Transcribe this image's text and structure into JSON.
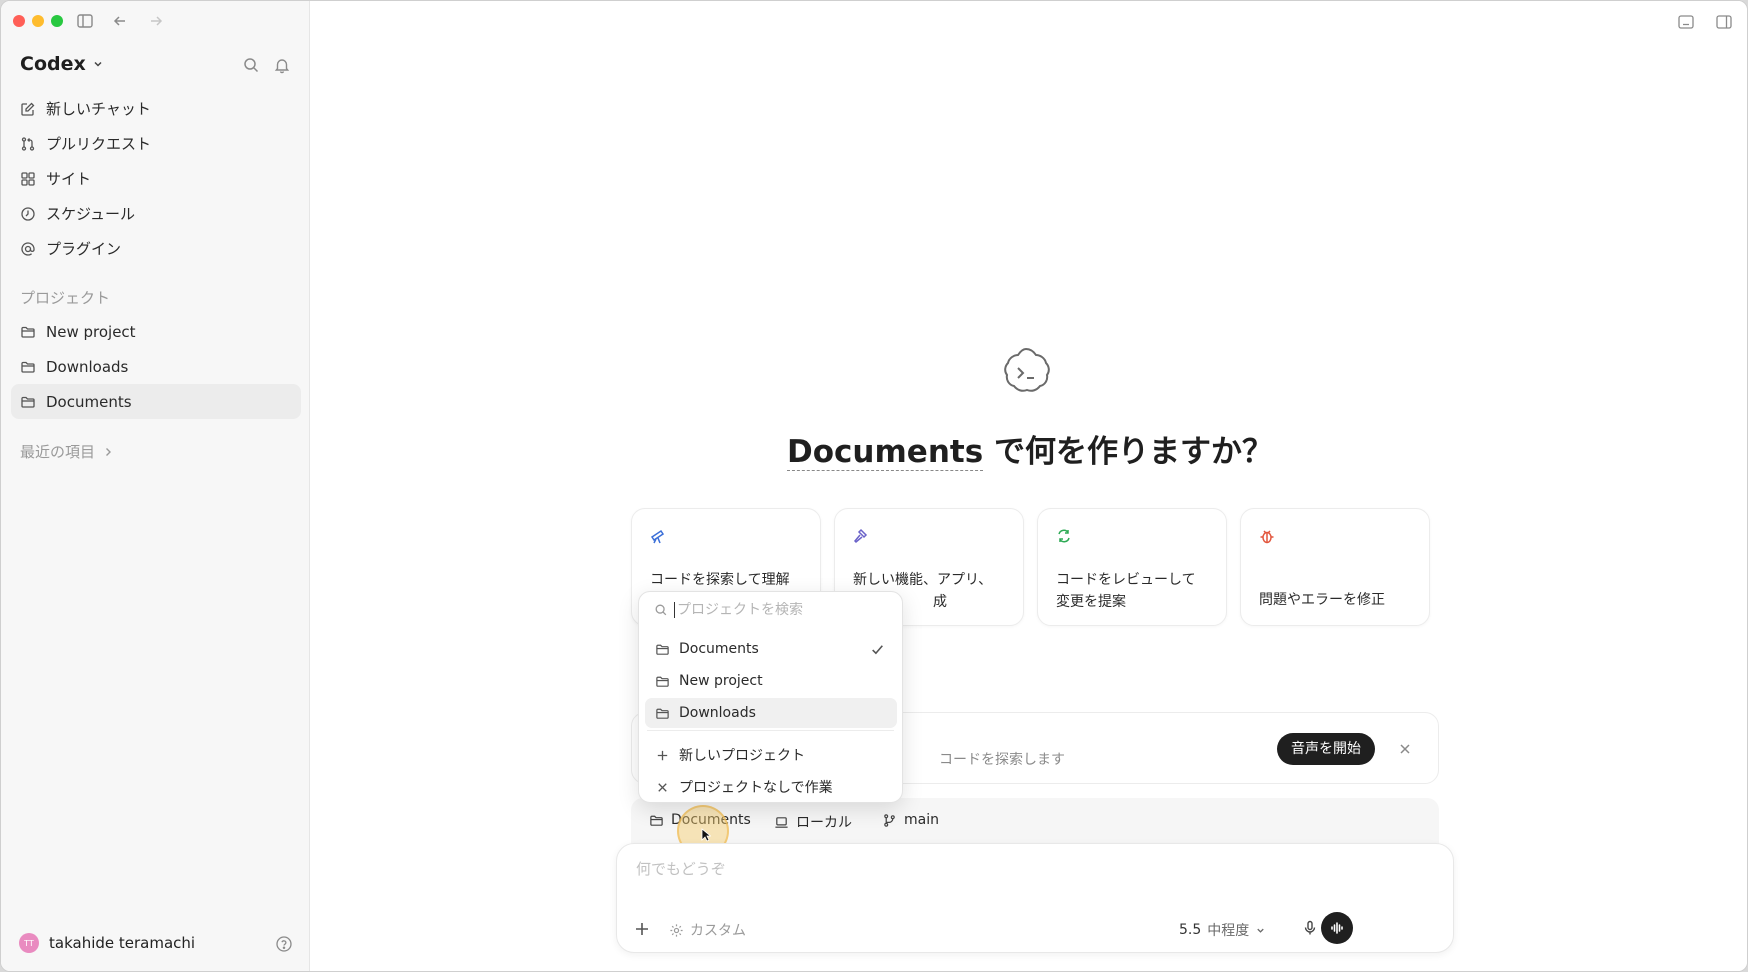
{
  "app": {
    "title": "Codex"
  },
  "sidebar": {
    "nav": [
      {
        "label": "新しいチャット",
        "icon": "edit-icon"
      },
      {
        "label": "プルリクエスト",
        "icon": "pull-request-icon"
      },
      {
        "label": "サイト",
        "icon": "grid-icon"
      },
      {
        "label": "スケジュール",
        "icon": "clock-icon"
      },
      {
        "label": "プラグイン",
        "icon": "at-icon"
      }
    ],
    "projects_label": "プロジェクト",
    "projects": [
      {
        "label": "New project"
      },
      {
        "label": "Downloads"
      },
      {
        "label": "Documents",
        "active": true
      }
    ],
    "recent_label": "最近の項目"
  },
  "user": {
    "name": "takahide teramachi",
    "initials": "TT"
  },
  "main": {
    "headline_project": "Documents",
    "headline_rest": " で何を作りますか？",
    "cards": [
      {
        "text": "コードを探索して理解",
        "icon": "telescope-icon",
        "color": "#3b6fd8"
      },
      {
        "text": "新しい機能、アプリ、",
        "text_suffix": "成",
        "icon": "hammer-icon",
        "color": "#6b63c9"
      },
      {
        "text": "コードをレビューして変更を提案",
        "icon": "refresh-icon",
        "color": "#2eaa55"
      },
      {
        "text": "問題やエラーを修正",
        "icon": "bug-icon",
        "color": "#e2553c"
      }
    ],
    "voice": {
      "hint": "コードを探索します",
      "button": "音声を開始"
    },
    "context": {
      "project": "Documents",
      "env": "ローカル",
      "branch": "main"
    },
    "composer": {
      "placeholder": "何でもどうぞ",
      "custom": "カスタム",
      "model_version": "5.5",
      "model_effort": "中程度"
    }
  },
  "dropdown": {
    "search_placeholder": "プロジェクトを検索",
    "items": [
      {
        "label": "Documents",
        "checked": true
      },
      {
        "label": "New project"
      },
      {
        "label": "Downloads",
        "hover": true
      }
    ],
    "new_project": "新しいプロジェクト",
    "no_project": "プロジェクトなしで作業"
  }
}
